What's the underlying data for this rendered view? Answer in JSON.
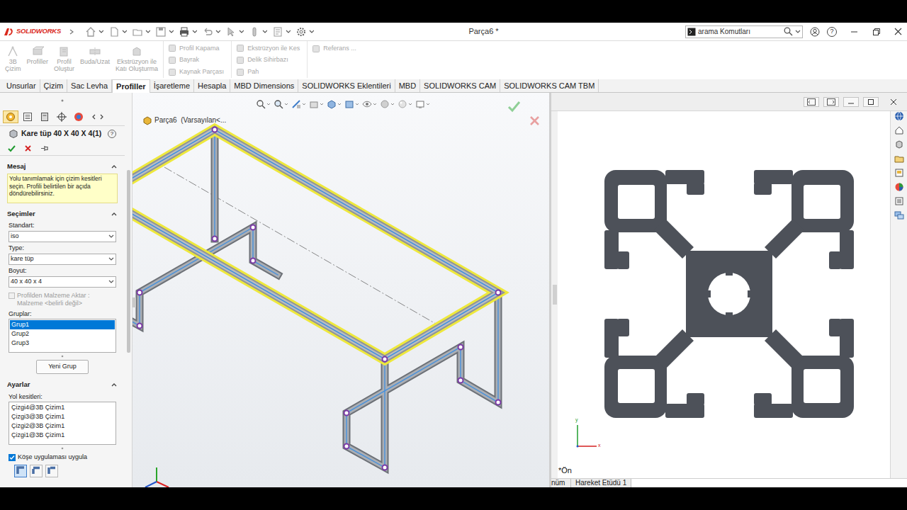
{
  "titlebar": {
    "logo": "SOLIDWORKS",
    "document_title": "Parça6 *",
    "search_placeholder": "arama Komutları",
    "help": "?"
  },
  "ribbon": {
    "large_buttons": [
      {
        "lines": [
          "3B",
          "Çizim"
        ],
        "disabled": true
      },
      {
        "lines": [
          "Profiller"
        ],
        "disabled": true
      },
      {
        "lines": [
          "Profil",
          "Oluştur"
        ],
        "disabled": true
      },
      {
        "lines": [
          "Buda/Uzat"
        ],
        "disabled": true
      },
      {
        "lines": [
          "Ekstrüzyon ile",
          "Katı Oluşturma"
        ],
        "disabled": true
      }
    ],
    "small_columns": [
      [
        {
          "label": "Profil Kapama",
          "disabled": true
        },
        {
          "label": "Bayrak",
          "disabled": true
        },
        {
          "label": "Kaynak Parçası",
          "disabled": true
        }
      ],
      [
        {
          "label": "Ekstrüzyon ile Kes",
          "disabled": true
        },
        {
          "label": "Delik Sihirbazı",
          "disabled": true
        },
        {
          "label": "Pah",
          "disabled": true
        }
      ],
      [
        {
          "label": "Referans ...",
          "disabled": true
        }
      ]
    ]
  },
  "tabs": [
    {
      "label": "Unsurlar",
      "selected": false
    },
    {
      "label": "Çizim",
      "selected": false
    },
    {
      "label": "Sac Levha",
      "selected": false
    },
    {
      "label": "Profiller",
      "selected": true
    },
    {
      "label": "İşaretleme",
      "selected": false
    },
    {
      "label": "Hesapla",
      "selected": false
    },
    {
      "label": "MBD Dimensions",
      "selected": false
    },
    {
      "label": "SOLIDWORKS Eklentileri",
      "selected": false
    },
    {
      "label": "MBD",
      "selected": false
    },
    {
      "label": "SOLIDWORKS CAM",
      "selected": false
    },
    {
      "label": "SOLIDWORKS CAM TBM",
      "selected": false
    }
  ],
  "property_manager": {
    "tabs": [
      {
        "kind": "feature",
        "selected": true
      },
      {
        "kind": "tree",
        "selected": false
      },
      {
        "kind": "config",
        "selected": false
      },
      {
        "kind": "dimxpert",
        "selected": false
      },
      {
        "kind": "display",
        "selected": false
      }
    ],
    "title": "Kare tüp 40 X 40 X 4(1)",
    "help": "?",
    "message": {
      "header": "Mesaj",
      "expanded": true,
      "text": "Yolu tanımlamak için çizim kesitleri seçin. Profili belirtilen bir açıda döndürebilirsiniz."
    },
    "selections": {
      "header": "Seçimler",
      "expanded": true,
      "fields": [
        {
          "label": "Standart:",
          "value": "iso"
        },
        {
          "label": "Type:",
          "value": "kare tüp"
        },
        {
          "label": "Boyut:",
          "value": "40 x 40 x 4"
        }
      ],
      "material": {
        "label": "Profilden Malzeme Aktar :",
        "sublabel": "Malzeme <belirli değil>",
        "checked": false,
        "disabled": true
      },
      "groups_label": "Gruplar:",
      "groups": [
        {
          "label": "Grup1",
          "selected": true
        },
        {
          "label": "Grup2",
          "selected": false
        },
        {
          "label": "Grup3",
          "selected": false
        }
      ],
      "new_group": "Yeni Grup"
    },
    "settings": {
      "header": "Ayarlar",
      "expanded": true,
      "paths_label": "Yol kesitleri:",
      "paths": [
        "Çizgi4@3B Çizim1",
        "Çizgi3@3B Çizim1",
        "Çizgi2@3B Çizim1",
        "Çizgi1@3B Çizim1"
      ],
      "corner": {
        "label": "Köşe uygulaması uygula",
        "checked": true
      },
      "corner_types": [
        {
          "kind": "miter",
          "selected": true
        },
        {
          "kind": "butt1",
          "selected": false
        },
        {
          "kind": "butt2",
          "selected": false
        }
      ]
    }
  },
  "viewport": {
    "tree_flyout": "Parça6  (Varsayılan<..."
  },
  "detail_view": {
    "view_label": "*Ön",
    "axis_x": "x",
    "axis_y": "y"
  },
  "bottom_tabs": [
    {
      "label": "nüm",
      "selected": false
    },
    {
      "label": "Hareket Etüdü 1",
      "selected": false
    }
  ]
}
